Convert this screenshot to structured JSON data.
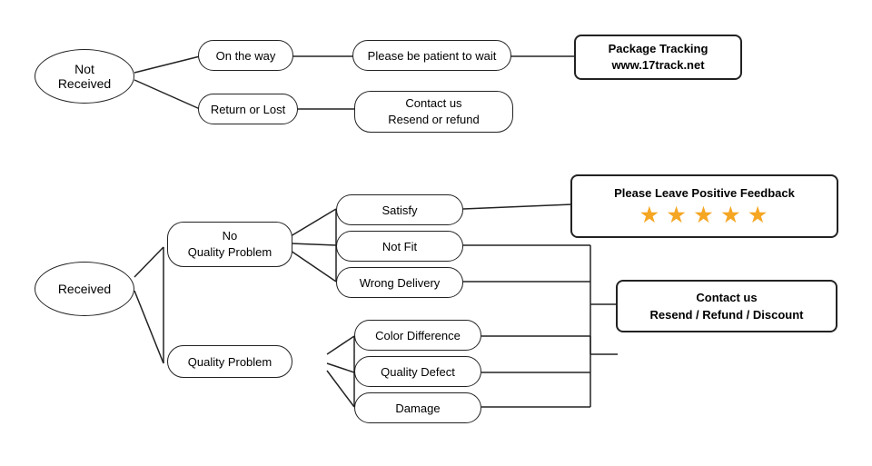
{
  "nodes": {
    "not_received": "Not\nReceived",
    "on_the_way": "On the way",
    "return_or_lost": "Return or Lost",
    "patient_wait": "Please be patient to wait",
    "contact_resend_refund": "Contact us\nResend or refund",
    "package_tracking": "Package Tracking\nwww.17track.net",
    "received": "Received",
    "no_quality_problem": "No\nQuality Problem",
    "quality_problem": "Quality Problem",
    "satisfy": "Satisfy",
    "not_fit": "Not Fit",
    "wrong_delivery": "Wrong Delivery",
    "color_difference": "Color Difference",
    "quality_defect": "Quality Defect",
    "damage": "Damage",
    "feedback": "Please Leave Positive Feedback",
    "stars": "★ ★ ★ ★ ★",
    "contact_resend_refund_discount": "Contact us\nResend / Refund / Discount"
  }
}
